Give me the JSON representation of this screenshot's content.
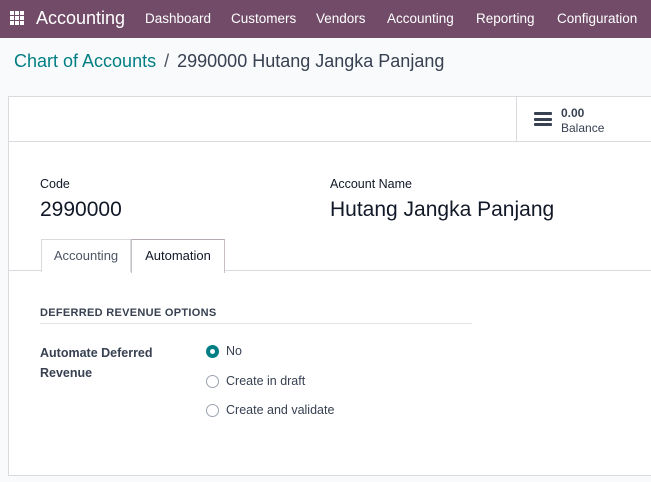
{
  "navbar": {
    "brand": "Accounting",
    "menu": [
      "Dashboard",
      "Customers",
      "Vendors",
      "Accounting",
      "Reporting",
      "Configuration"
    ]
  },
  "breadcrumb": {
    "parent": "Chart of Accounts",
    "separator": "/",
    "current": "2990000 Hutang Jangka Panjang"
  },
  "balance": {
    "value": "0.00",
    "label": "Balance"
  },
  "form": {
    "code_label": "Code",
    "code_value": "2990000",
    "name_label": "Account Name",
    "name_value": "Hutang Jangka Panjang"
  },
  "tabs": [
    {
      "label": "Accounting",
      "active": false
    },
    {
      "label": "Automation",
      "active": true
    }
  ],
  "automation": {
    "section_title": "DEFERRED REVENUE OPTIONS",
    "option_label": "Automate Deferred Revenue",
    "choices": [
      {
        "label": "No",
        "checked": true
      },
      {
        "label": "Create in draft",
        "checked": false
      },
      {
        "label": "Create and validate",
        "checked": false
      }
    ]
  },
  "colors": {
    "navbar": "#714b67",
    "accent": "#017e84"
  }
}
